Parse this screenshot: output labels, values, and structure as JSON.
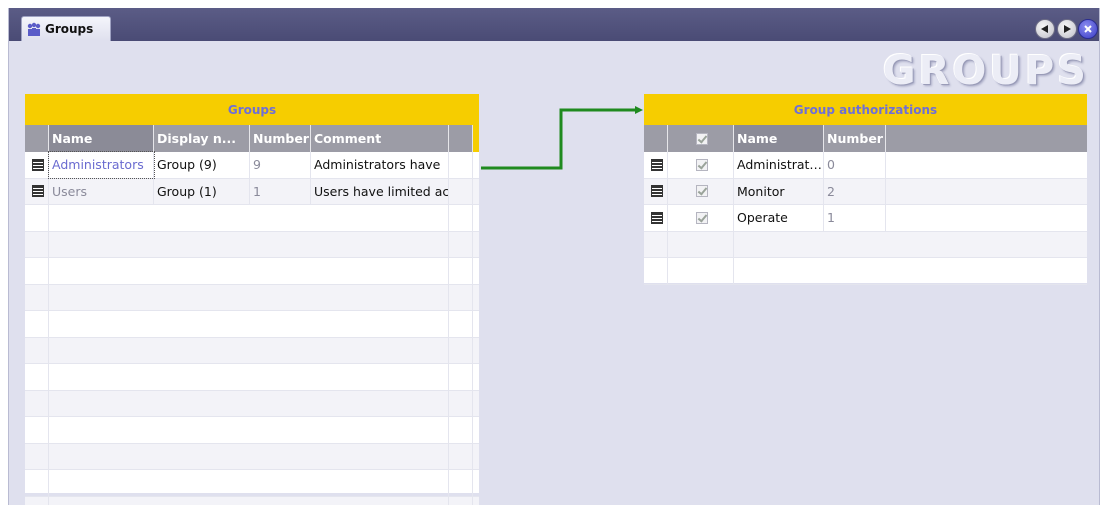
{
  "window": {
    "tab_label": "Groups",
    "watermark_title": "GROUPS",
    "colors": {
      "titlebar": "#4f5079",
      "accent_header": "#f6cd00",
      "title_text": "#6e6fd8",
      "connector": "#1f8a1f"
    }
  },
  "groups_table": {
    "title": "Groups",
    "columns": [
      "Name",
      "Display n...",
      "Number",
      "Comment"
    ],
    "rows": [
      {
        "name": "Administrators",
        "display_name": "Group (9)",
        "number": "9",
        "comment": "Administrators have"
      },
      {
        "name": "Users",
        "display_name": "Group (1)",
        "number": "1",
        "comment": "Users have limited ac"
      }
    ],
    "empty_rows": 12
  },
  "authorizations_table": {
    "title": "Group authorizations",
    "columns": [
      "",
      "Name",
      "Number"
    ],
    "rows": [
      {
        "checked": true,
        "name": "Administrat…",
        "number": "0"
      },
      {
        "checked": true,
        "name": "Monitor",
        "number": "2"
      },
      {
        "checked": true,
        "name": "Operate",
        "number": "1"
      }
    ],
    "empty_rows": 2
  },
  "icons": {
    "tab": "groups-icon",
    "prev": "prev-icon",
    "next": "next-icon",
    "close": "close-icon",
    "row_header": "row-header-icon"
  }
}
